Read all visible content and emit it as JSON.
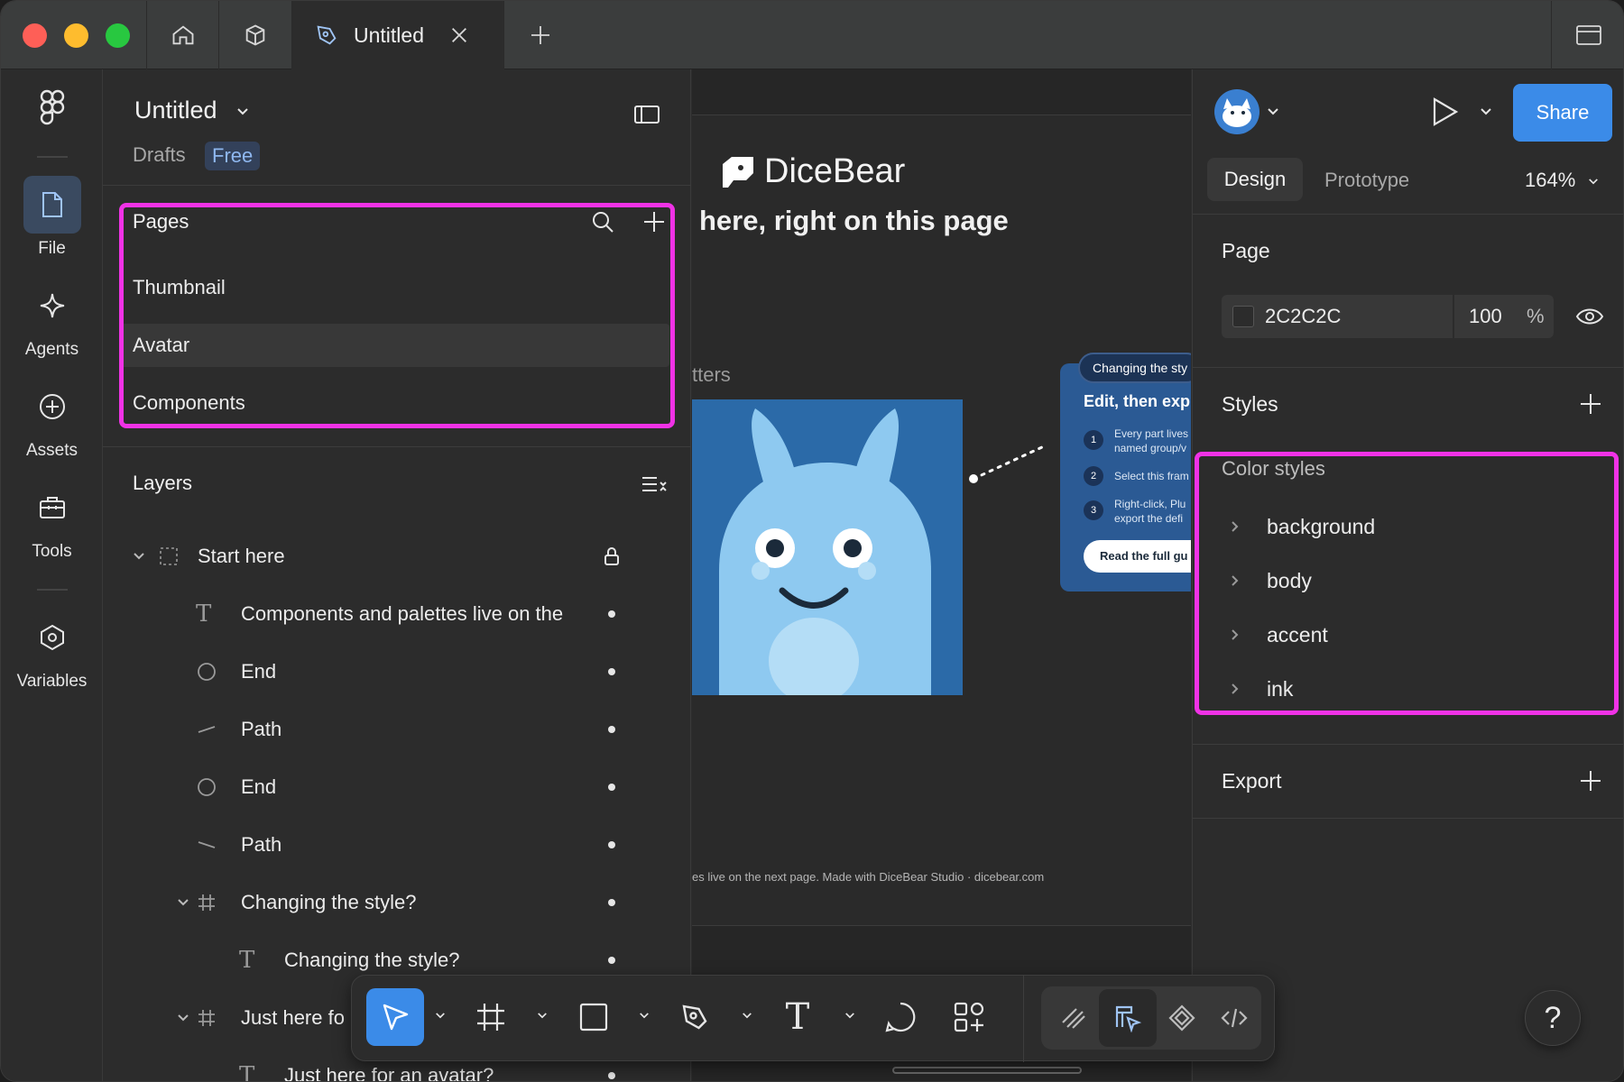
{
  "tabbar": {
    "tab_title": "Untitled"
  },
  "rail": {
    "items": [
      {
        "label": "File",
        "icon": "file-icon"
      },
      {
        "label": "Agents",
        "icon": "sparkle-icon"
      },
      {
        "label": "Assets",
        "icon": "plus-circle-icon"
      },
      {
        "label": "Tools",
        "icon": "toolbox-icon"
      },
      {
        "label": "Variables",
        "icon": "hexagon-icon"
      }
    ]
  },
  "left_panel": {
    "file_title": "Untitled",
    "drafts_label": "Drafts",
    "plan_badge": "Free",
    "pages_heading": "Pages",
    "pages": [
      "Thumbnail",
      "Avatar",
      "Components"
    ],
    "selected_page": "Avatar",
    "layers_heading": "Layers",
    "layers": [
      {
        "name": "Start here",
        "type": "frame",
        "locked": true
      },
      {
        "name": "Components and palettes live on the",
        "type": "text"
      },
      {
        "name": "End",
        "type": "ellipse"
      },
      {
        "name": "Path",
        "type": "path"
      },
      {
        "name": "End",
        "type": "ellipse"
      },
      {
        "name": "Path",
        "type": "path"
      },
      {
        "name": "Changing the style?",
        "type": "frame-grid"
      },
      {
        "name": "Changing the style?",
        "type": "text"
      },
      {
        "name": "Just here fo",
        "type": "frame-grid"
      },
      {
        "name": "Just here for an avatar?",
        "type": "text"
      }
    ]
  },
  "canvas": {
    "brand": "DiceBear",
    "headline": "here, right on this page",
    "side_label": "tters",
    "card_tag": "Changing the sty",
    "card_title": "Edit, then exp",
    "card_steps": [
      {
        "n": "1",
        "text1": "Every part lives",
        "text2": "named group/v"
      },
      {
        "n": "2",
        "text1": "Select this fram",
        "text2": ""
      },
      {
        "n": "3",
        "text1": "Right-click, Plu",
        "text2": "export the defi"
      }
    ],
    "card_button": "Read the full gu",
    "footer_text": "es live on the next page. Made with DiceBear Studio · dicebear.com"
  },
  "right_panel": {
    "share_label": "Share",
    "tab_design": "Design",
    "tab_prototype": "Prototype",
    "zoom": "164%",
    "page_heading": "Page",
    "page_color_hex": "2C2C2C",
    "page_opacity": "100",
    "percent_sign": "%",
    "styles_heading": "Styles",
    "color_styles_heading": "Color styles",
    "color_styles": [
      "background",
      "body",
      "accent",
      "ink"
    ],
    "export_heading": "Export"
  },
  "colors": {
    "accent_blue": "#3b8be8",
    "highlight": "#f032e6",
    "avatar_bg": "#2b6aa8",
    "avatar_body": "#8ec9f0",
    "traffic_red": "#fe5f57",
    "traffic_yellow": "#febc2e",
    "traffic_green": "#28c840"
  },
  "help": "?"
}
